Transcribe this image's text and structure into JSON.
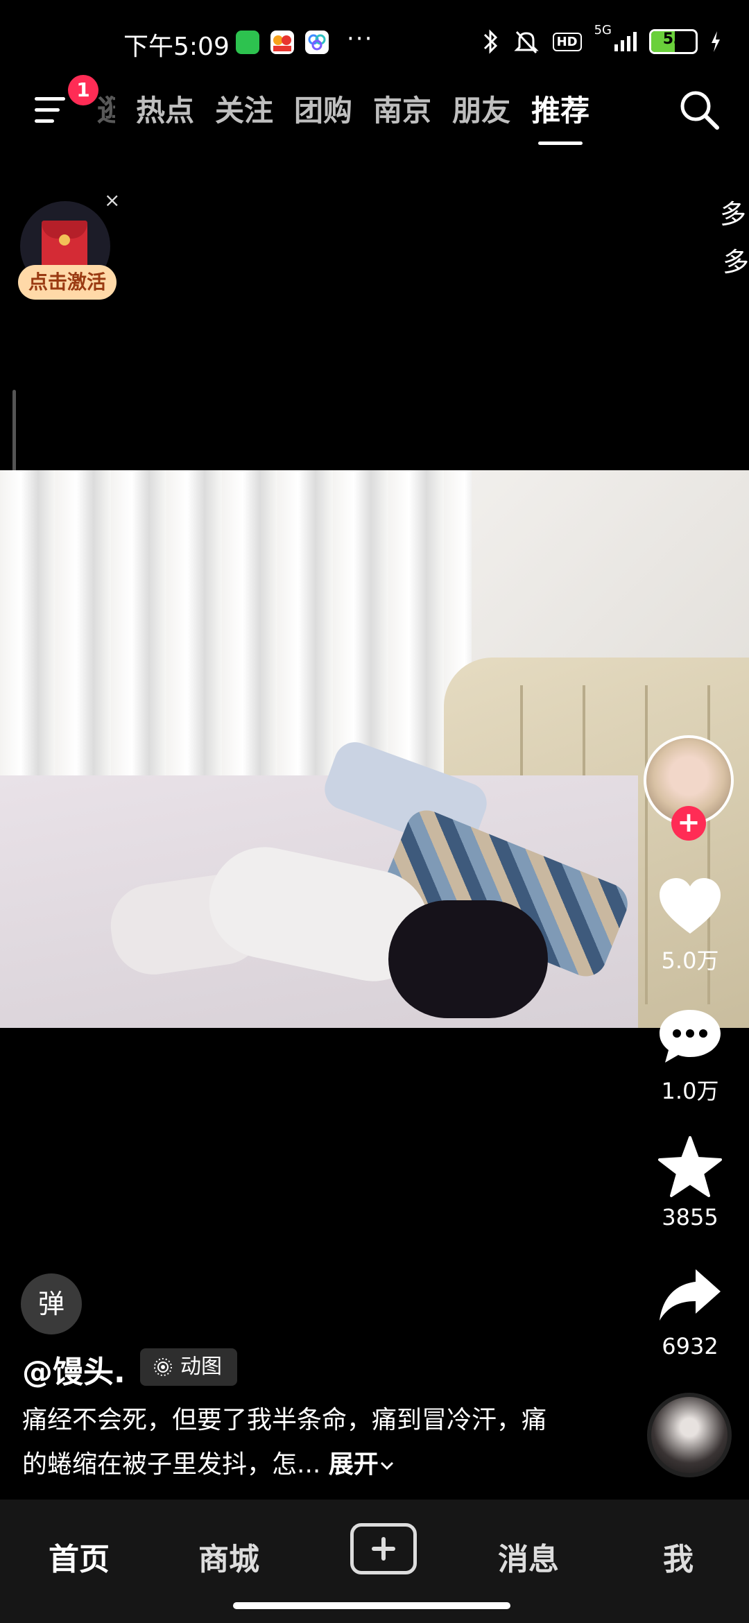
{
  "status_bar": {
    "time": "下午5:09",
    "app_icons": [
      "wechat-icon",
      "58-app-icon",
      "cloud-app-icon"
    ],
    "more": "···",
    "network": "5G",
    "hd": "HD",
    "battery": "53",
    "battery_level_percent": 53
  },
  "top_nav": {
    "menu_badge": "1",
    "tabs": [
      "逛",
      "热点",
      "关注",
      "团购",
      "南京",
      "朋友",
      "推荐"
    ],
    "active_tab": "推荐"
  },
  "red_packet": {
    "label": "点击激活",
    "close": "×"
  },
  "side_partial": [
    "多",
    "多"
  ],
  "actions": {
    "like_count": "5.0万",
    "comment_count": "1.0万",
    "favorite_count": "3855",
    "share_count": "6932",
    "follow_label": "+"
  },
  "post": {
    "danmu_label": "弹",
    "author": "@馒头.",
    "tag": "动图",
    "description": "痛经不会死，但要了我半条命，痛到冒冷汗，痛的蜷缩在被子里发抖，怎...",
    "expand": "展开"
  },
  "bottom_nav": {
    "home": "首页",
    "mall": "商城",
    "messages": "消息",
    "me": "我"
  },
  "colors": {
    "accent": "#ff2c55",
    "background": "#000000",
    "battery_fill": "#6ad03b"
  }
}
